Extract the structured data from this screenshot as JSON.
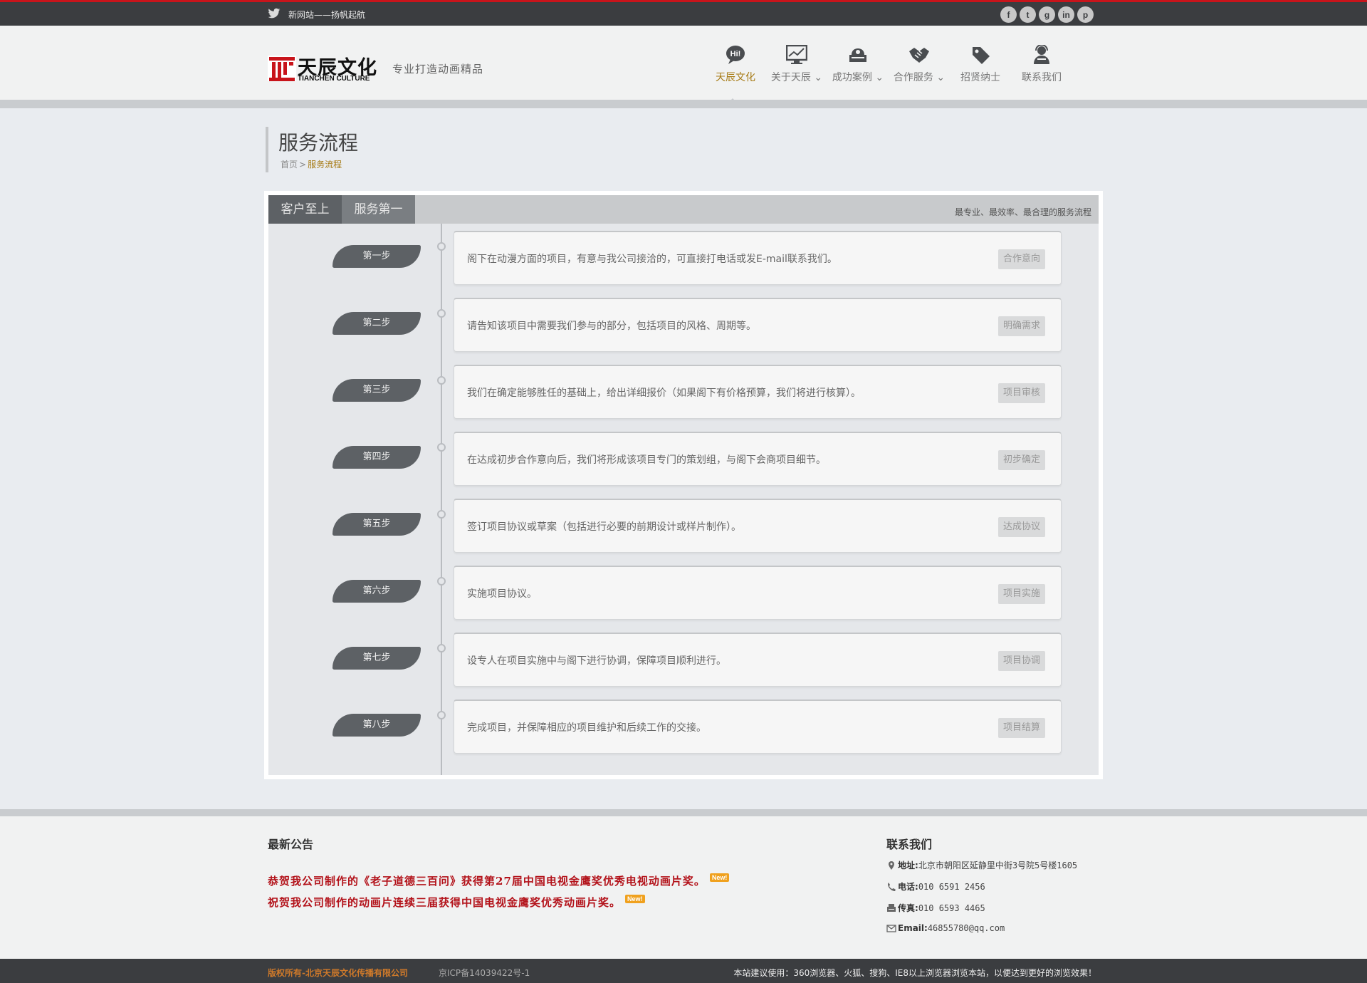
{
  "topbar": {
    "announcement": "新网站——扬帆起航",
    "social": [
      {
        "name": "facebook-icon",
        "glyph": "f"
      },
      {
        "name": "twitter-icon",
        "glyph": "t"
      },
      {
        "name": "google-plus-icon",
        "glyph": "g"
      },
      {
        "name": "linkedin-icon",
        "glyph": "in"
      },
      {
        "name": "pinterest-icon",
        "glyph": "p"
      }
    ]
  },
  "header": {
    "logo_cn": "天辰文化",
    "logo_en": "TIANCHEN CULTURE",
    "slogan": "专业打造动画精品",
    "nav": [
      {
        "label": "天辰文化",
        "icon": "hi-bubble-icon",
        "active": true
      },
      {
        "label": "关于天辰 ⌄",
        "icon": "chart-monitor-icon"
      },
      {
        "label": "成功案例 ⌄",
        "icon": "cases-icon"
      },
      {
        "label": "合作服务 ⌄",
        "icon": "handshake-icon"
      },
      {
        "label": "招贤纳士",
        "icon": "tag-icon"
      },
      {
        "label": "联系我们",
        "icon": "operator-icon"
      }
    ]
  },
  "page": {
    "title": "服务流程",
    "breadcrumb_home": "首页",
    "breadcrumb_sep": ">",
    "breadcrumb_current": "服务流程"
  },
  "process": {
    "tabs": [
      "客户至上",
      "服务第一"
    ],
    "hint": "最专业、最效率、最合理的服务流程",
    "steps": [
      {
        "label": "第一步",
        "text": "阁下在动漫方面的项目，有意与我公司接洽的，可直接打电话或发E-mail联系我们。",
        "tag": "合作意向"
      },
      {
        "label": "第二步",
        "text": "请告知该项目中需要我们参与的部分，包括项目的风格、周期等。",
        "tag": "明确需求"
      },
      {
        "label": "第三步",
        "text": "我们在确定能够胜任的基础上，给出详细报价（如果阁下有价格预算，我们将进行核算）。",
        "tag": "项目审核"
      },
      {
        "label": "第四步",
        "text": "在达成初步合作意向后，我们将形成该项目专门的策划组，与阁下会商项目细节。",
        "tag": "初步确定"
      },
      {
        "label": "第五步",
        "text": "签订项目协议或草案（包括进行必要的前期设计或样片制作）。",
        "tag": "达成协议"
      },
      {
        "label": "第六步",
        "text": "实施项目协议。",
        "tag": "项目实施"
      },
      {
        "label": "第七步",
        "text": "设专人在项目实施中与阁下进行协调，保障项目顺利进行。",
        "tag": "项目协调"
      },
      {
        "label": "第八步",
        "text": "完成项目，并保障相应的项目维护和后续工作的交接。",
        "tag": "项目结算"
      }
    ]
  },
  "footer": {
    "news_heading": "最新公告",
    "news": [
      {
        "text": "恭贺我公司制作的《老子道德三百问》获得第27届中国电视金鹰奖优秀电视动画片奖。",
        "badge": "New!"
      },
      {
        "text": "祝贺我公司制作的动画片连续三届获得中国电视金鹰奖优秀动画片奖。",
        "badge": "New!"
      }
    ],
    "contact_heading": "联系我们",
    "contact": {
      "address_label": "地址:",
      "address": "北京市朝阳区延静里中街3号院5号楼1605",
      "phone_label": "电话:",
      "phone": "010 6591 2456",
      "fax_label": "传真:",
      "fax": "010 6593 4465",
      "email_label": "Email:",
      "email": "46855780@qq.com"
    },
    "copyright": "版权所有-北京天辰文化传播有限公司",
    "icp": "京ICP备14039422号-1",
    "browser_hint": "本站建议使用：360浏览器、火狐、搜狗、IE8以上浏览器浏览本站，以便达到更好的浏览效果！"
  },
  "colors": {
    "accent": "#a67a14",
    "brand_red": "#c8141b",
    "dark_bar": "#3b3d40",
    "news_red": "#b3121a"
  }
}
